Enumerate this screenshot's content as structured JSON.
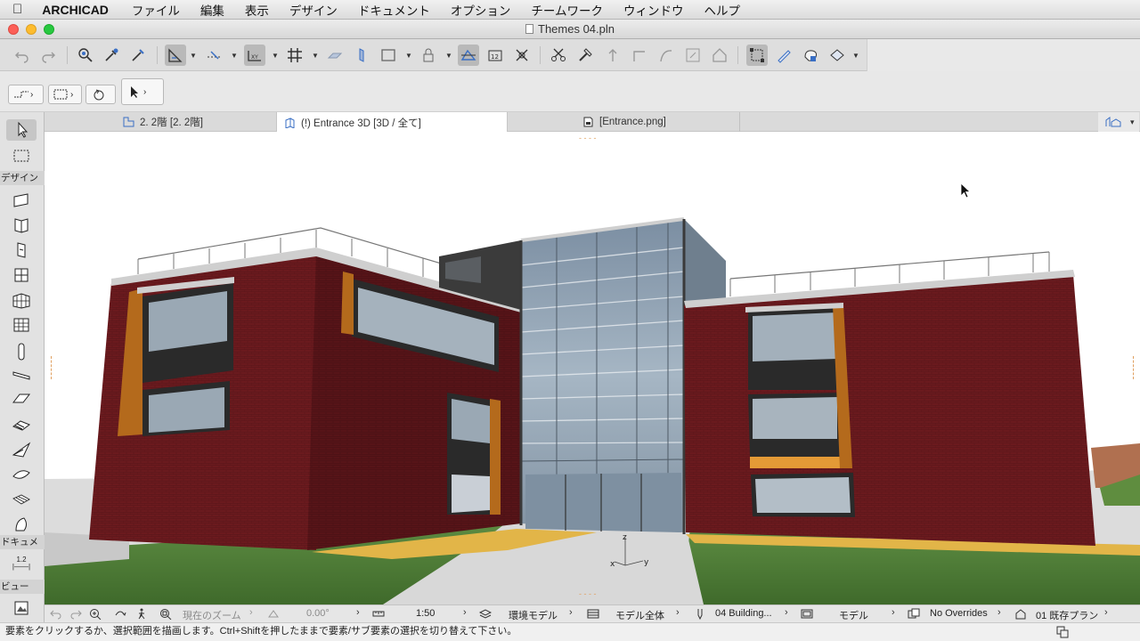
{
  "menubar": {
    "app_name": "ARCHICAD",
    "items": [
      "ファイル",
      "編集",
      "表示",
      "デザイン",
      "ドキュメント",
      "オプション",
      "チームワーク",
      "ウィンドウ",
      "ヘルプ"
    ]
  },
  "window": {
    "title": "Themes 04.pln"
  },
  "tabs": [
    {
      "label": "2. 2階 [2. 2階]",
      "icon": "floor-plan-icon",
      "active": false
    },
    {
      "label": "(!) Entrance 3D [3D / 全て]",
      "icon": "3d-window-icon",
      "active": true
    },
    {
      "label": "[Entrance.png]",
      "icon": "image-file-icon",
      "active": false
    }
  ],
  "toolbox": {
    "group_design": "デザイン",
    "group_document": "ドキュメ",
    "group_view": "ビュー",
    "dimension_label": "1.2"
  },
  "viewport": {
    "axis_z": "z",
    "axis_x": "x",
    "axis_y": "y"
  },
  "navbar": {
    "zoom_label": "現在のズーム",
    "angle": "0.00°",
    "scale": "1:50",
    "model_view": "環境モデル",
    "layer_combo": "モデル全体",
    "pen_set": "04 Building...",
    "model_display": "モデル",
    "overrides": "No Overrides",
    "renovation": "01 既存プラン"
  },
  "status": {
    "message": "要素をクリックするか、選択範囲を描画します。Ctrl+Shiftを押したままで要素/サブ要素の選択を切り替えて下さい。"
  },
  "colors": {
    "brick": "#6b1a1e",
    "glass": "#8fa3b4",
    "lawn": "#4f7d38",
    "accent_yellow": "#e0b548"
  }
}
